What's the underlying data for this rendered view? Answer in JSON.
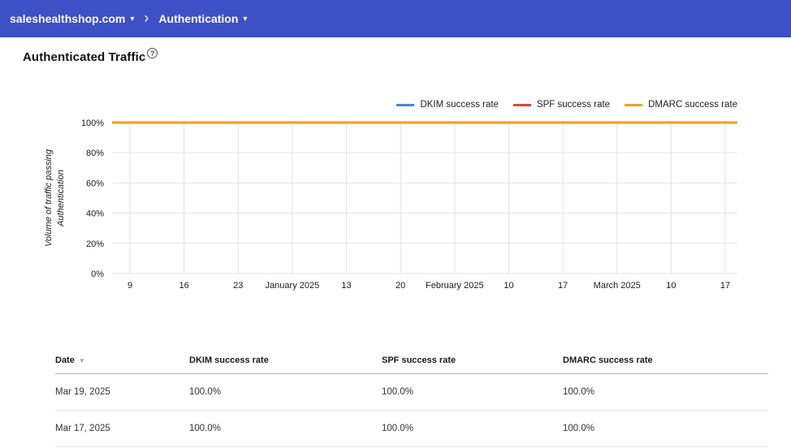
{
  "colors": {
    "header_bg": "#3e50c6",
    "grid": "#e3e3e3",
    "axis_text": "#1a1a1a"
  },
  "topnav": {
    "domain": "saleshealthshop.com",
    "section": "Authentication",
    "caret": "▾",
    "separator": "›"
  },
  "page": {
    "title": "Authenticated Traffic",
    "help_icon": "?"
  },
  "chart_data": {
    "type": "line",
    "title": "Authenticated Traffic",
    "ylabel": "Volume of traffic passing Authentication",
    "xlabel": "",
    "ylim": [
      0,
      100
    ],
    "grid": true,
    "legend_position": "top-right",
    "y_ticks": [
      "0%",
      "20%",
      "40%",
      "60%",
      "80%",
      "100%"
    ],
    "categories": [
      "9",
      "16",
      "23",
      "January 2025",
      "13",
      "20",
      "February 2025",
      "10",
      "17",
      "March 2025",
      "10",
      "17"
    ],
    "series": [
      {
        "name": "DKIM success rate",
        "color": "#4285f4",
        "values": [
          100,
          100,
          100,
          100,
          100,
          100,
          100,
          100,
          100,
          100,
          100,
          100
        ]
      },
      {
        "name": "SPF success rate",
        "color": "#db4437",
        "values": [
          100,
          100,
          100,
          100,
          100,
          100,
          100,
          100,
          100,
          100,
          100,
          100
        ]
      },
      {
        "name": "DMARC success rate",
        "color": "#f2a117",
        "values": [
          100,
          100,
          100,
          100,
          100,
          100,
          100,
          100,
          100,
          100,
          100,
          100
        ]
      }
    ]
  },
  "table": {
    "headers": [
      "Date",
      "DKIM success rate",
      "SPF success rate",
      "DMARC success rate"
    ],
    "sort_icon": "▼",
    "rows": [
      {
        "date": "Mar 19, 2025",
        "dkim": "100.0%",
        "spf": "100.0%",
        "dmarc": "100.0%"
      },
      {
        "date": "Mar 17, 2025",
        "dkim": "100.0%",
        "spf": "100.0%",
        "dmarc": "100.0%"
      }
    ]
  }
}
